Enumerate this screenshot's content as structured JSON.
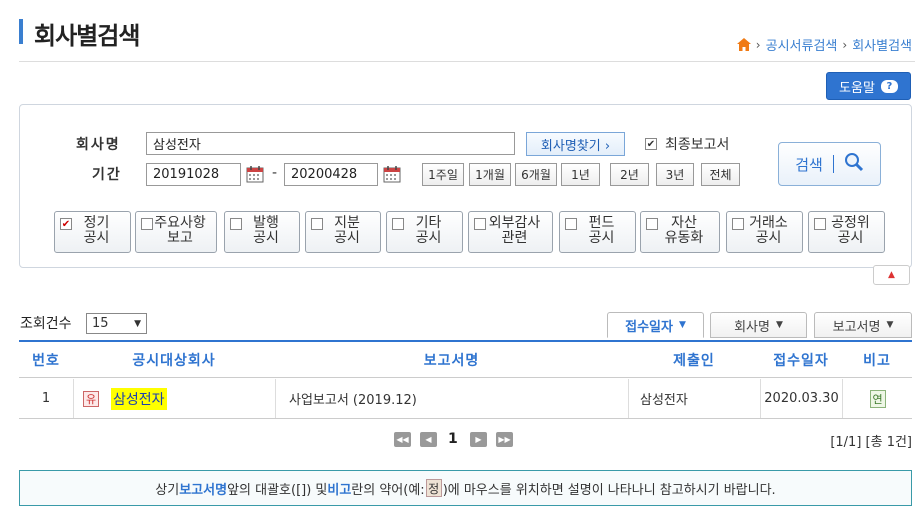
{
  "header": {
    "title": "회사별검색",
    "breadcrumb": [
      "공시서류검색",
      "회사별검색"
    ],
    "help_label": "도움말"
  },
  "search": {
    "company_label": "회사명",
    "company_value": "삼성전자",
    "find_company_label": "회사명찾기 ›",
    "final_report_label": "최종보고서",
    "final_report_checked": true,
    "period_label": "기간",
    "start_date": "20191028",
    "end_date": "20200428",
    "period_buttons": [
      "1주일",
      "1개월",
      "6개월",
      "1년",
      "2년",
      "3년",
      "전체"
    ],
    "search_button_label": "검색",
    "categories": [
      {
        "line1": "정기",
        "line2": "공시",
        "checked": true
      },
      {
        "line1": "주요사항",
        "line2": "보고",
        "checked": false
      },
      {
        "line1": "발행",
        "line2": "공시",
        "checked": false
      },
      {
        "line1": "지분",
        "line2": "공시",
        "checked": false
      },
      {
        "line1": "기타",
        "line2": "공시",
        "checked": false
      },
      {
        "line1": "외부감사",
        "line2": "관련",
        "checked": false
      },
      {
        "line1": "펀드",
        "line2": "공시",
        "checked": false
      },
      {
        "line1": "자산",
        "line2": "유동화",
        "checked": false
      },
      {
        "line1": "거래소",
        "line2": "공시",
        "checked": false
      },
      {
        "line1": "공정위",
        "line2": "공시",
        "checked": false
      }
    ]
  },
  "results": {
    "count_label": "조회건수",
    "count_value": "15",
    "sort_tabs": [
      "접수일자",
      "회사명",
      "보고서명"
    ],
    "columns": [
      "번호",
      "공시대상회사",
      "보고서명",
      "제출인",
      "접수일자",
      "비고"
    ],
    "rows": [
      {
        "no": "1",
        "badge": "유",
        "company": "삼성전자",
        "report": "사업보고서 (2019.12)",
        "submitter": "삼성전자",
        "date": "2020.03.30",
        "note": "연"
      }
    ],
    "page": "1",
    "page_info": "[1/1] [총 1건]"
  },
  "notice": {
    "part1": "상기 ",
    "bold1": "보고서명",
    "part2": " 앞의 대괄호([]) 및 ",
    "bold2": "비고",
    "part3": "란의 약어(예:",
    "example": "정",
    "part4": ")에 마우스를 위치하면 설명이 나타나니 참고하시기 바랍니다."
  }
}
